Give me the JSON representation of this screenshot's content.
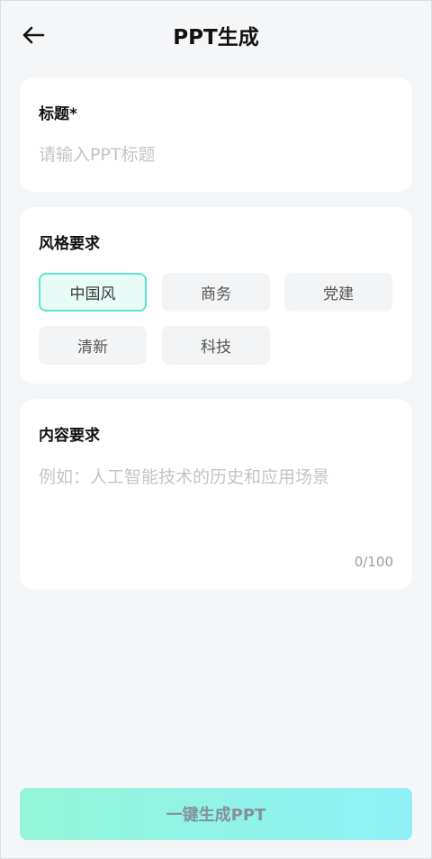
{
  "header": {
    "title": "PPT生成",
    "back_icon": "arrow-left-icon"
  },
  "title_card": {
    "label": "标题*",
    "input_value": "",
    "input_placeholder": "请输入PPT标题"
  },
  "style_card": {
    "label": "风格要求",
    "selected": "中国风",
    "options": [
      "中国风",
      "商务",
      "党建",
      "清新",
      "科技"
    ]
  },
  "content_card": {
    "label": "内容要求",
    "input_value": "",
    "input_placeholder": "例如：人工智能技术的历史和应用场景",
    "counter": "0/100"
  },
  "footer": {
    "generate_label": "一键生成PPT"
  },
  "colors": {
    "background": "#f5f6f8",
    "chip_selected_border": "#5fe4cf",
    "button_gradient_start": "#93f6d7",
    "button_gradient_end": "#8ff1f6"
  }
}
